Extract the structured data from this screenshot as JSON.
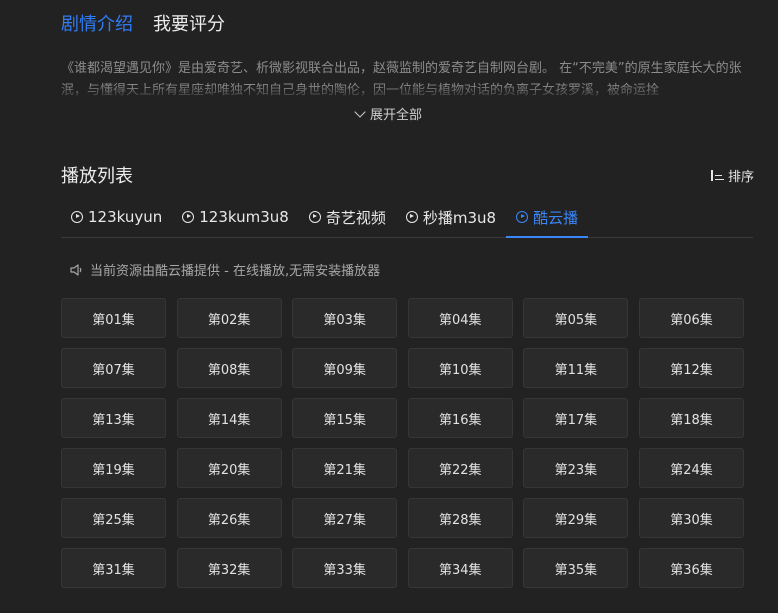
{
  "top_tabs": [
    {
      "label": "剧情介绍",
      "active": true
    },
    {
      "label": "我要评分",
      "active": false
    }
  ],
  "synopsis": {
    "text": "《谁都渴望遇见你》是由爱奇艺、析微影视联合出品，赵薇监制的爱奇艺自制网台剧。 在“不完美”的原生家庭长大的张泯，与懂得天上所有星座却唯独不知自己身世的陶伦，因一位能与植物对话的负离子女孩罗溪，被命运拴",
    "expand_label": "展开全部"
  },
  "playlist": {
    "title": "播放列表",
    "sort_label": "排序",
    "sources": [
      {
        "label": "123kuyun",
        "active": false
      },
      {
        "label": "123kum3u8",
        "active": false
      },
      {
        "label": "奇艺视频",
        "active": false
      },
      {
        "label": "秒播m3u8",
        "active": false
      },
      {
        "label": "酷云播",
        "active": true
      }
    ],
    "notice": "当前资源由酷云播提供 - 在线播放,无需安装播放器",
    "episodes": [
      "第01集",
      "第02集",
      "第03集",
      "第04集",
      "第05集",
      "第06集",
      "第07集",
      "第08集",
      "第09集",
      "第10集",
      "第11集",
      "第12集",
      "第13集",
      "第14集",
      "第15集",
      "第16集",
      "第17集",
      "第18集",
      "第19集",
      "第20集",
      "第21集",
      "第22集",
      "第23集",
      "第24集",
      "第25集",
      "第26集",
      "第27集",
      "第28集",
      "第29集",
      "第30集",
      "第31集",
      "第32集",
      "第33集",
      "第34集",
      "第35集",
      "第36集"
    ]
  },
  "colors": {
    "accent": "#2f7cf6",
    "background": "#222222",
    "episode_bg": "#2a2a2a"
  },
  "icons": {
    "source_tab": "play-circle-icon",
    "expand": "chevron-down-icon",
    "sort": "sort-list-icon",
    "notice": "speaker-icon"
  }
}
